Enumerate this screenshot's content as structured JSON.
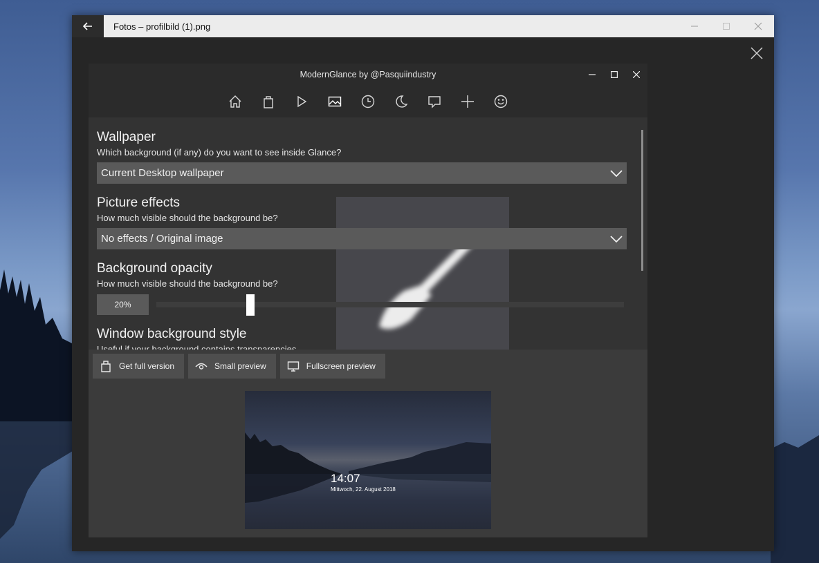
{
  "photos_window": {
    "title": "Fotos – profilbild (1).png"
  },
  "glance_window": {
    "title": "ModernGlance by @Pasquiindustry"
  },
  "nav_icons": [
    "home-icon",
    "shopping-bag-icon",
    "play-icon",
    "picture-icon",
    "clock-icon",
    "moon-icon",
    "message-icon",
    "plus-icon",
    "smiley-icon"
  ],
  "settings": {
    "wallpaper": {
      "title": "Wallpaper",
      "subtitle": "Which background (if any) do you want to see inside Glance?",
      "value": "Current Desktop wallpaper"
    },
    "picture_effects": {
      "title": "Picture effects",
      "subtitle": "How much visible should the background be?",
      "value": "No effects / Original image"
    },
    "background_opacity": {
      "title": "Background opacity",
      "subtitle": "How much visible should the background be?",
      "value_label": "20%",
      "value": 0.2
    },
    "window_background_style": {
      "title": "Window background style",
      "subtitle": "Useful if your background contains transparencies"
    }
  },
  "actions": {
    "full_version": "Get full version",
    "small_preview": "Small preview",
    "fullscreen_preview": "Fullscreen preview"
  },
  "preview": {
    "time": "14:07",
    "date": "Mittwoch, 22. August 2018"
  },
  "colors": {
    "panel_bg": "#333333",
    "dropdown_bg": "#5a5a5a",
    "button_bg": "#4e4e4e"
  }
}
